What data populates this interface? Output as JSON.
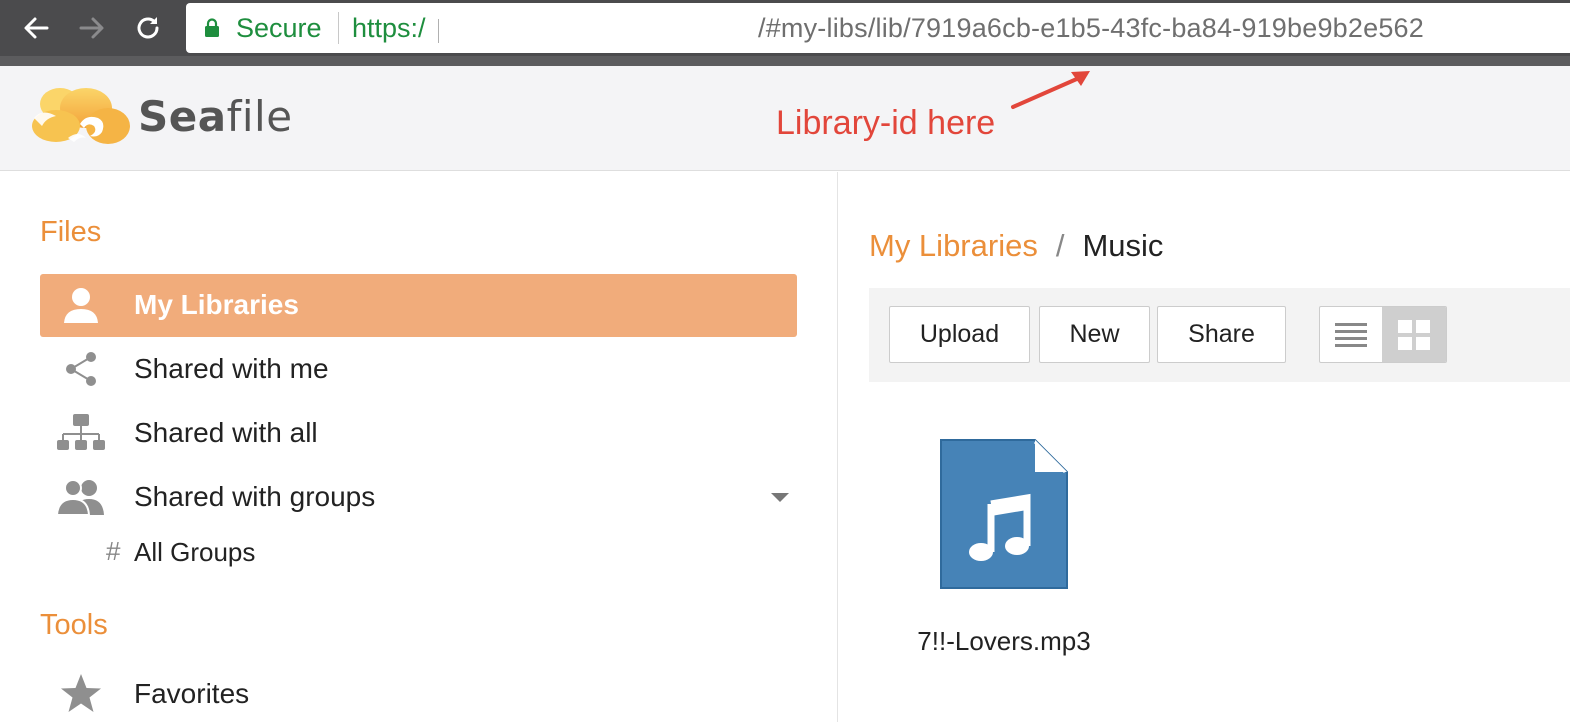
{
  "browser": {
    "secure_label": "Secure",
    "url_scheme": "https:/",
    "url_path": "/#my-libs/lib/7919a6cb-e1b5-43fc-ba84-919be9b2e562"
  },
  "header": {
    "logo_text_bold": "Sea",
    "logo_text_rest": "file",
    "annotation": "Library-id here",
    "annotation_color": "#e2463b"
  },
  "sidebar": {
    "files_heading": "Files",
    "items": [
      {
        "label": "My Libraries",
        "icon": "user-icon",
        "active": true
      },
      {
        "label": "Shared with me",
        "icon": "share-icon"
      },
      {
        "label": "Shared with all",
        "icon": "org-chart-icon"
      },
      {
        "label": "Shared with groups",
        "icon": "group-icon"
      }
    ],
    "sub_items": [
      {
        "label": "All Groups",
        "icon": "hash-icon"
      }
    ],
    "tools_heading": "Tools",
    "tools_items": [
      {
        "label": "Favorites",
        "icon": "star-icon"
      }
    ],
    "accent_color": "#eb8f3a",
    "active_color": "#f1ac7b"
  },
  "main": {
    "breadcrumb": {
      "root": "My Libraries",
      "separator": "/",
      "current": "Music"
    },
    "toolbar": {
      "upload_label": "Upload",
      "new_label": "New",
      "share_label": "Share"
    },
    "files": [
      {
        "name": "7!!-Lovers.mp3",
        "icon": "music-file-icon"
      }
    ]
  }
}
